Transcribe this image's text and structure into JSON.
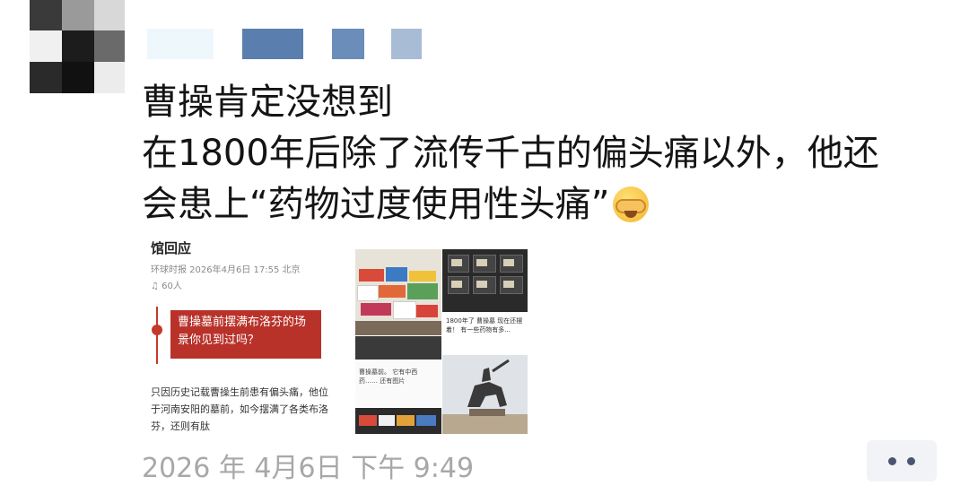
{
  "colors": {
    "text": "#141414",
    "timestamp": "#a8a8a8",
    "banner": "#b8322a",
    "more_dots": "#4a5573"
  },
  "post": {
    "line1": "曹操肯定没想到",
    "line2": "在1800年后除了流传千古的偏头痛以外，他还",
    "line3": "会患上“药物过度使用性头痛”",
    "emoji": "facepalm-laughing-emoji"
  },
  "shared_left": {
    "title": "馆回应",
    "meta": "环球时报  2026年4月6日 17:55 北京",
    "reads": "60人",
    "banner": "曹操墓前摆满布洛芬的场景你见到过吗？",
    "body": "只因历史记载曹操生前患有偏头痛，他位于河南安阳的墓前，如今摆满了各类布洛芬，还则有肽"
  },
  "shared_right": {
    "tile3_text": "1800年了 曹操墓 现在还摆着！ 有一些药物有多...",
    "tile5_text": "曹操墓前。 它有中西 药…… 还有图片"
  },
  "footer": {
    "timestamp": "2026 年 4月6日 下午 9:49",
    "more_icon": "more-dots-icon"
  }
}
